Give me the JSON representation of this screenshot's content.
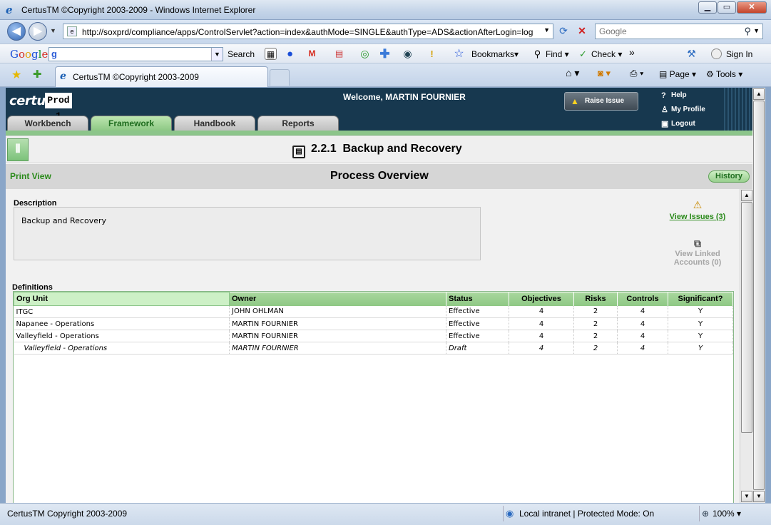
{
  "browser": {
    "window_title": "CertusTM ©Copyright 2003-2009 - Windows Internet Explorer",
    "url": "http://soxprd/compliance/apps/ControlServlet?action=index&authMode=SINGLE&authType=ADS&actionAfterLogin=log",
    "search_placeholder": "Google",
    "google_toolbar": {
      "search_label": "Search",
      "bookmarks_label": "Bookmarks",
      "find_label": "Find",
      "check_label": "Check",
      "more_label": "»",
      "signin_label": "Sign In"
    },
    "tab_title": "CertusTM ©Copyright 2003-2009",
    "command_bar": {
      "page_label": "Page",
      "tools_label": "Tools"
    },
    "status": {
      "message": "CertusTM Copyright 2003-2009",
      "zone": "Local intranet | Protected Mode: On",
      "zoom": "100%"
    }
  },
  "app": {
    "logo": "certus",
    "environment": "Prod 1",
    "welcome": "Welcome, MARTIN FOURNIER",
    "raise_issue_label": "Raise Issue",
    "top_links": {
      "help": "Help",
      "profile": "My Profile",
      "logout": "Logout"
    },
    "tabs": [
      {
        "label": "Workbench",
        "active": false
      },
      {
        "label": "Framework",
        "active": true
      },
      {
        "label": "Handbook",
        "active": false
      },
      {
        "label": "Reports",
        "active": false
      }
    ],
    "process_number": "2.2.1",
    "process_name": "Backup and Recovery",
    "print_view_label": "Print View",
    "section_title": "Process Overview",
    "history_label": "History",
    "description_label": "Description",
    "description_text": "Backup and Recovery",
    "view_issues_label": "View Issues (3)",
    "view_linked_line1": "View Linked",
    "view_linked_line2": "Accounts (0)",
    "definitions_label": "Definitions",
    "table": {
      "columns": [
        "Org Unit",
        "Owner",
        "Status",
        "Objectives",
        "Risks",
        "Controls",
        "Significant?"
      ],
      "rows": [
        {
          "org_unit": "ITGC",
          "owner": "JOHN  OHLMAN",
          "status": "Effective",
          "objectives": "4",
          "risks": "2",
          "controls": "4",
          "significant": "Y"
        },
        {
          "org_unit": "Napanee - Operations",
          "owner": "MARTIN  FOURNIER",
          "status": "Effective",
          "objectives": "4",
          "risks": "2",
          "controls": "4",
          "significant": "Y"
        },
        {
          "org_unit": "Valleyfield - Operations",
          "owner": "MARTIN  FOURNIER",
          "status": "Effective",
          "objectives": "4",
          "risks": "2",
          "controls": "4",
          "significant": "Y"
        },
        {
          "org_unit": "Valleyfield - Operations",
          "owner": "MARTIN  FOURNIER",
          "status": "Draft",
          "objectives": "4",
          "risks": "2",
          "controls": "4",
          "significant": "Y"
        }
      ]
    }
  }
}
